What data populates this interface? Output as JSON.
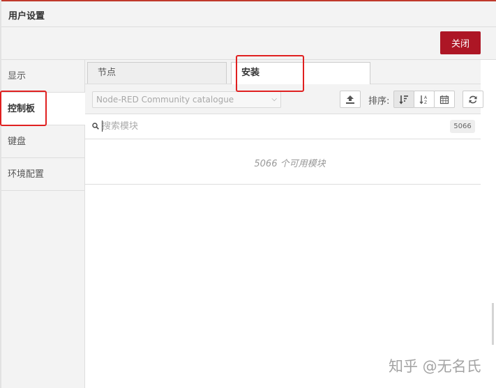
{
  "dialog": {
    "title": "用户设置",
    "close_label": "关闭",
    "accent_color": "#ad1625"
  },
  "sidebar": {
    "items": [
      {
        "label": "显示"
      },
      {
        "label": "控制板"
      },
      {
        "label": "键盘"
      },
      {
        "label": "环境配置"
      }
    ],
    "active": "控制板"
  },
  "tabs": [
    {
      "label": "节点"
    },
    {
      "label": "安装"
    }
  ],
  "active_tab": "安装",
  "toolbar": {
    "catalogue_selected": "Node-RED Community catalogue",
    "sort_label": "排序:",
    "icons": [
      "upload-icon",
      "sort-relevance-icon",
      "sort-az-icon",
      "calendar-icon",
      "refresh-icon"
    ]
  },
  "search": {
    "placeholder": "搜索模块",
    "count": "5066"
  },
  "results": {
    "message": "5066 个可用模块"
  },
  "watermark": {
    "text": "知乎 @无名氏"
  }
}
